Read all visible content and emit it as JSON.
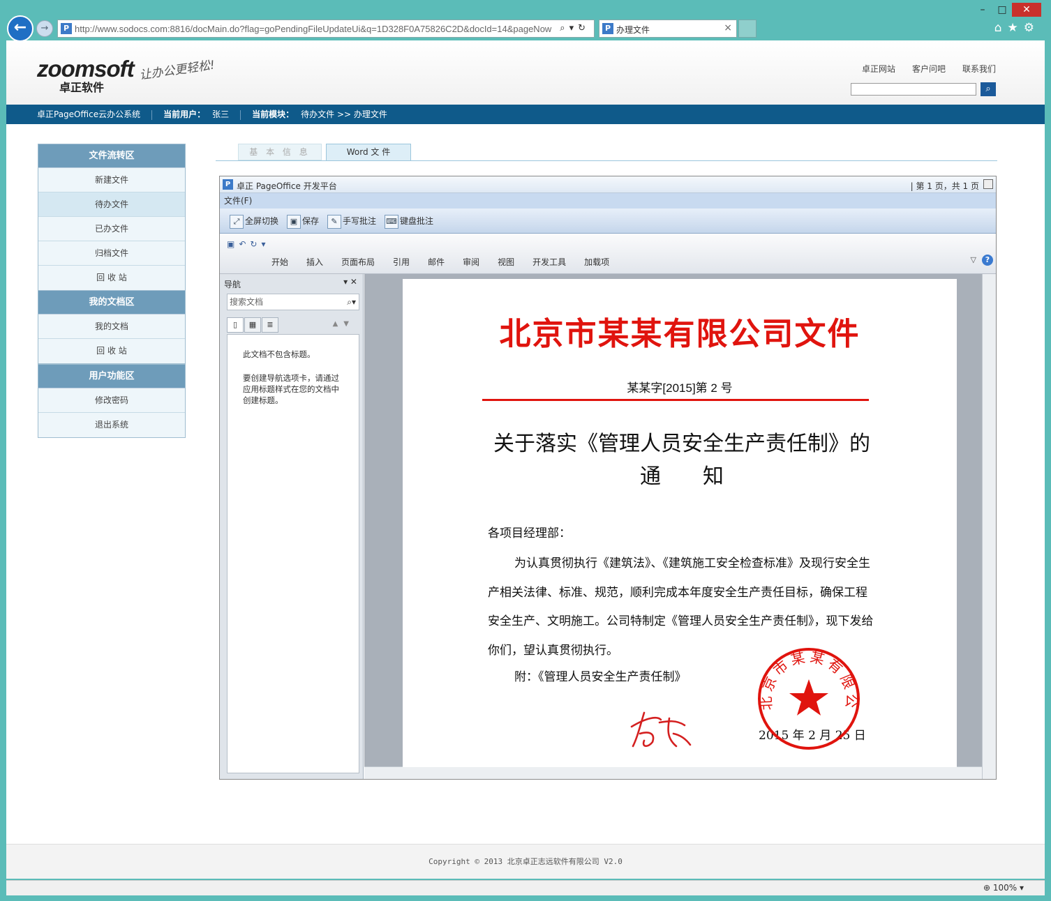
{
  "browser": {
    "url": "http://www.sodocs.com:8816/docMain.do?flag=goPendingFileUpdateUi&q=1D328F0A75826C2D&docId=14&pageNow",
    "tab_title": "办理文件",
    "zoom": "100%"
  },
  "header": {
    "logo_text": "zoomsoft",
    "logo_cn": "卓正软件",
    "slogan": "让办公更轻松!",
    "links": [
      "卓正网站",
      "客户问吧",
      "联系我们"
    ]
  },
  "infobar": {
    "system": "卓正PageOffice云办公系统",
    "user_label": "当前用户：",
    "user": "张三",
    "module_label": "当前模块：",
    "module": "待办文件 >> 办理文件"
  },
  "sidebar": {
    "groups": [
      {
        "title": "文件流转区",
        "items": [
          "新建文件",
          "待办文件",
          "已办文件",
          "归档文件",
          "回 收 站"
        ]
      },
      {
        "title": "我的文档区",
        "items": [
          "我的文档",
          "回 收 站"
        ]
      },
      {
        "title": "用户功能区",
        "items": [
          "修改密码",
          "退出系统"
        ]
      }
    ]
  },
  "tabs": [
    "基 本 信 息",
    "Word 文 件"
  ],
  "pageoffice": {
    "title": "卓正 PageOffice 开发平台",
    "page_info": "| 第 1 页，共 1 页",
    "menu": "文件(F)",
    "toolbar": [
      "全屏切换",
      "保存",
      "手写批注",
      "键盘批注"
    ]
  },
  "ribbon": {
    "tabs": [
      "开始",
      "插入",
      "页面布局",
      "引用",
      "邮件",
      "审阅",
      "视图",
      "开发工具",
      "加载项"
    ]
  },
  "nav_pane": {
    "title": "导航",
    "search_placeholder": "搜索文档",
    "msg1": "此文档不包含标题。",
    "msg2": "要创建导航选项卡，请通过应用标题样式在您的文档中创建标题。"
  },
  "document": {
    "red_header": "北京市某某有限公司文件",
    "doc_no": "某某字[2015]第 2 号",
    "title_line1": "关于落实《管理人员安全生产责任制》的",
    "title_line2": "通知",
    "salutation": "各项目经理部：",
    "body": "为认真贯彻执行《建筑法》、《建筑施工安全检查标准》及现行安全生产相关法律、标准、规范，顺利完成本年度安全生产责任目标，确保工程安全生产、文明施工。公司特制定《管理人员安全生产责任制》，现下发给你们，望认真贯彻执行。",
    "attachment": "附：《管理人员安全生产责任制》",
    "signature": "李志",
    "date": "2015 年 2 月 25 日",
    "seal_text": "北京市某某有限公司"
  },
  "footer": {
    "copyright": "Copyright © 2013 北京卓正志远软件有限公司 V2.0"
  },
  "colors": {
    "accent": "#0f5a8a",
    "red": "#e0140e",
    "sidebar_header": "#6e9cba"
  }
}
